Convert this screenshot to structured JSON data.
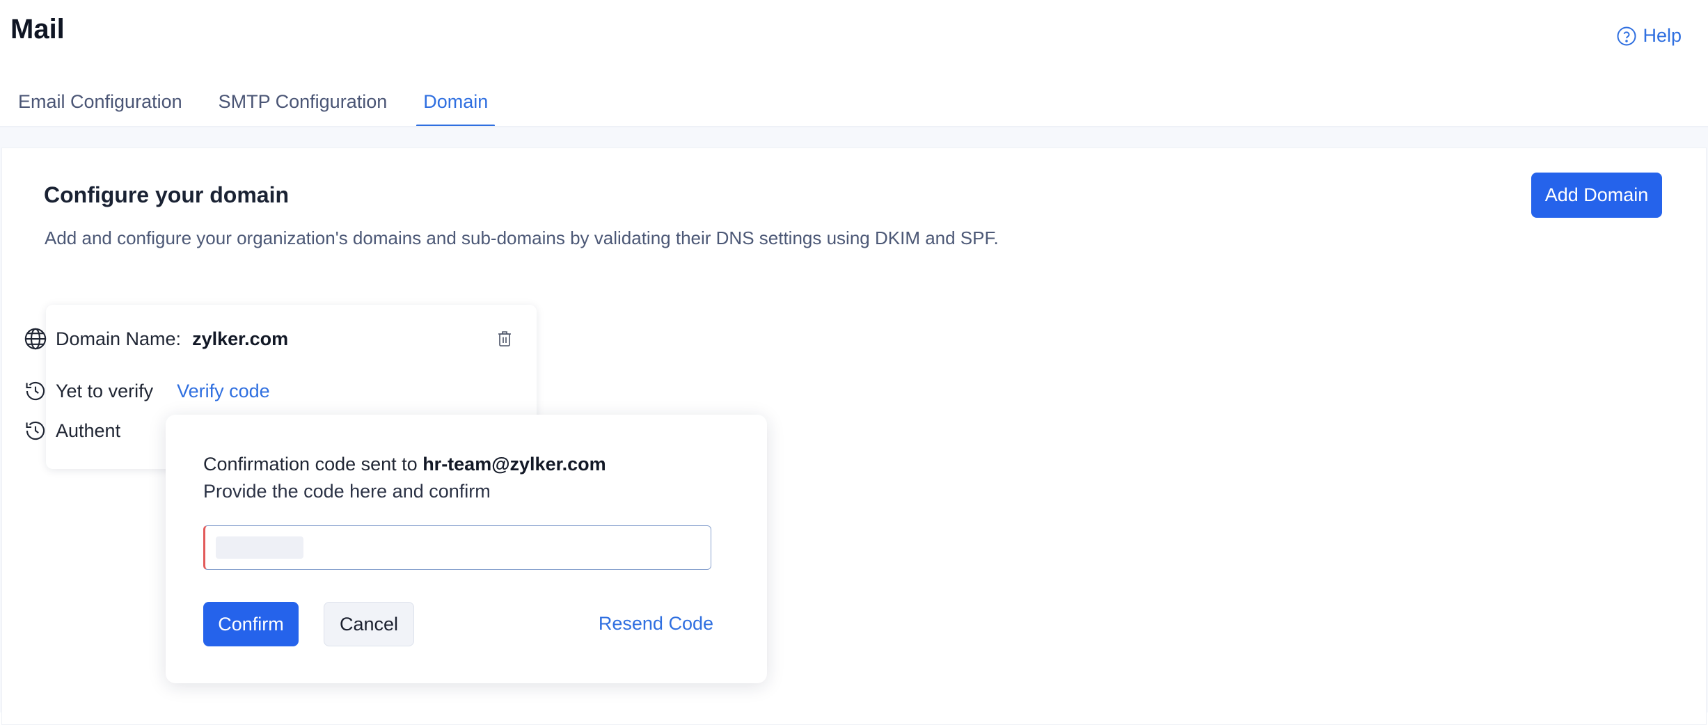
{
  "header": {
    "title": "Mail",
    "help_label": "Help"
  },
  "tabs": [
    {
      "label": "Email Configuration",
      "active": false
    },
    {
      "label": "SMTP Configuration",
      "active": false
    },
    {
      "label": "Domain",
      "active": true
    }
  ],
  "section": {
    "title": "Configure your domain",
    "description": "Add and configure your organization's domains and sub-domains by validating their DNS settings using DKIM and SPF.",
    "add_button_label": "Add Domain"
  },
  "domain_card": {
    "domain_label": "Domain Name:",
    "domain_value": "zylker.com",
    "status_label": "Yet to verify",
    "verify_link_label": "Verify code",
    "auth_label_visible": "Authent"
  },
  "verify_popover": {
    "message_prefix": "Confirmation code sent to",
    "email": "hr-team@zylker.com",
    "instruction": "Provide the code here and confirm",
    "input_value": "",
    "confirm_label": "Confirm",
    "cancel_label": "Cancel",
    "resend_label": "Resend Code"
  },
  "colors": {
    "accent": "#2563eb",
    "link": "#2f6fe0",
    "input_error_edge": "#e25a5a"
  },
  "icons": {
    "help": "help-circle-icon",
    "globe": "globe-icon",
    "history": "clock-history-icon",
    "delete": "trash-icon"
  }
}
